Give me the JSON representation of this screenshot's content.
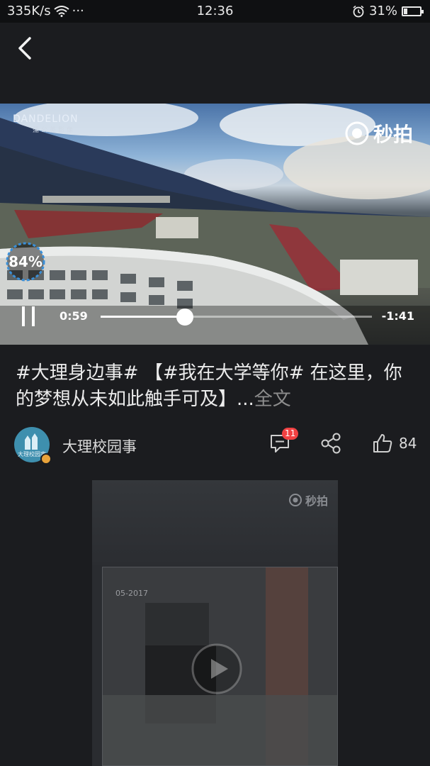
{
  "status_bar": {
    "speed": "335K/s",
    "more": "···",
    "time": "12:36",
    "battery": "31%",
    "battery_level": 0.31
  },
  "video": {
    "brand": "DANDELION",
    "brand_sub": "蒲公英影像",
    "watermark": "秒拍",
    "loading_percent": "84%",
    "current_time": "0:59",
    "remaining_time": "-1:41",
    "progress": 0.31
  },
  "caption": {
    "text": "#大理身边事# 【#我在大学等你# 在这里，你的梦想从未如此触手可及】...",
    "more": "全文"
  },
  "author": {
    "name": "大理校园事",
    "avatar_label": "大理校园事",
    "comment_count": "11",
    "like_count": "84"
  },
  "next_video": {
    "watermark": "秒拍",
    "stamp": "05-2017"
  },
  "colors": {
    "background": "#1b1c1f",
    "badge": "#f04142",
    "avatar": "#3e8fae",
    "verify": "#e9a33a"
  },
  "icons": [
    "wifi-icon",
    "alarm-icon",
    "battery-icon",
    "back-icon",
    "camera-icon",
    "pause-icon",
    "comment-icon",
    "share-icon",
    "like-icon",
    "play-icon"
  ]
}
